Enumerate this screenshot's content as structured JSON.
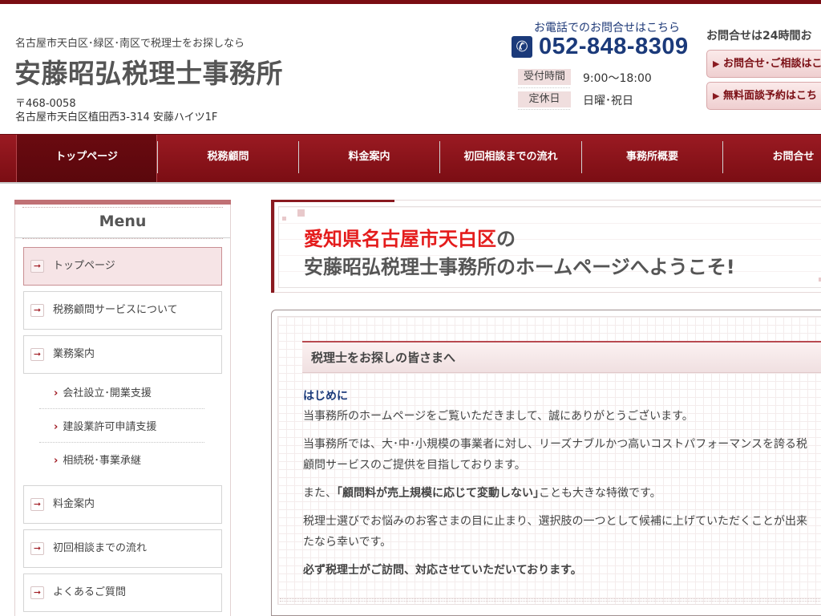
{
  "header": {
    "tagline": "名古屋市天白区･緑区･南区で税理士をお探しなら",
    "site_title": "安藤昭弘税理士事務所",
    "zip": "〒468-0058",
    "address": "名古屋市天白区植田西3-314 安藤ハイツ1F",
    "tel_caption": "お電話でのお問合せはこちら",
    "tel_number": "052-848-8309",
    "hours_label": "受付時間",
    "hours_value": "9:00〜18:00",
    "holiday_label": "定休日",
    "holiday_value": "日曜･祝日",
    "contact_caption": "お問合せは24時間お",
    "contact_btn1": "お問合せ･ご相談はこ",
    "contact_btn2": "無料面談予約はこち"
  },
  "nav": {
    "items": [
      "トップページ",
      "税務顧問",
      "料金案内",
      "初回相談までの流れ",
      "事務所概要",
      "お問合せ"
    ]
  },
  "sidebar": {
    "title": "Menu",
    "items": [
      "トップページ",
      "税務顧問サービスについて",
      "業務案内",
      "料金案内",
      "初回相談までの流れ",
      "よくあるご質問"
    ],
    "sub_items": [
      "会社設立･開業支援",
      "建設業許可申請支援",
      "相続税･事業承継"
    ]
  },
  "banner": {
    "line1_red": "愛知県名古屋市天白区",
    "line1_rest": "の",
    "line2": "安藤昭弘税理士事務所のホームページへようこそ!"
  },
  "content": {
    "section_title": "税理士をお探しの皆さまへ",
    "heading": "はじめに",
    "p1": "当事務所のホームページをご覧いただきまして、誠にありがとうございます。",
    "p2a": "当事務所では、大･中･小規模の事業者に対し、リーズナブルかつ高いコストパフォーマンスを誇る税",
    "p2b": "顧問サービスのご提供を目指しております。",
    "p3_pre": "また、",
    "p3_bold": "｢顧問料が売上規模に応じて変動しない｣",
    "p3_post": "ことも大きな特徴です。",
    "p4a": "税理士選びでお悩みのお客さまの目に止まり、選択肢の一つとして候補に上げていただくことが出来",
    "p4b": "たなら幸いです。",
    "p5": "必ず税理士がご訪問、対応させていただいております。"
  },
  "icons": {
    "phone": "phone-icon",
    "menu_arrow": "arrow-right-icon",
    "sub_arrow": "chevron-right-icon"
  },
  "colors": {
    "brand": "#7a0d13",
    "phone_blue": "#1b3a7a",
    "accent_red": "#e41c1c"
  }
}
